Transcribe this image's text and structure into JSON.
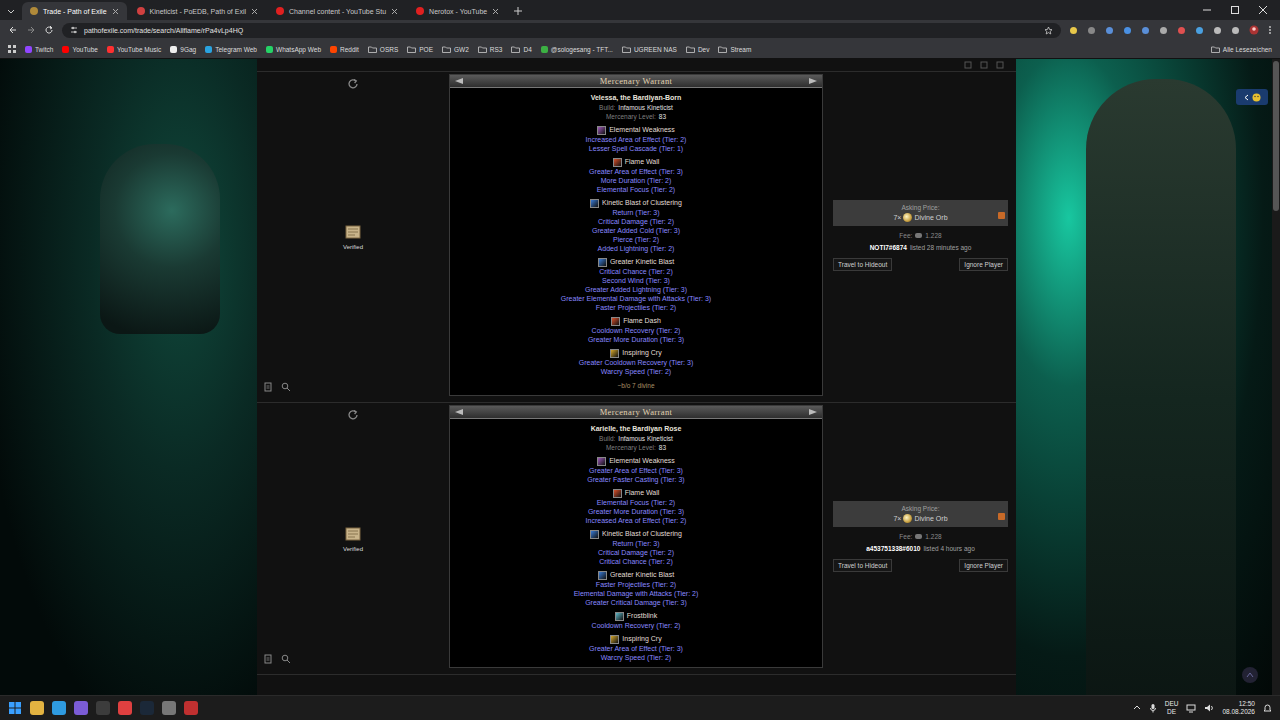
{
  "browser": {
    "tabs": [
      {
        "label": "Trade - Path of Exile",
        "selected": true,
        "color": "#b08a3a"
      },
      {
        "label": "Kineticist - PoEDB, Path of Exil",
        "selected": false,
        "color": "#d04040"
      },
      {
        "label": "Channel content - YouTube Stu",
        "selected": false,
        "color": "#e02020"
      },
      {
        "label": "Nerotox - YouTube",
        "selected": false,
        "color": "#e02020"
      }
    ],
    "address": "pathofexile.com/trade/search/Allflame/rPa4vLp4HQ",
    "bookmarks": [
      {
        "label": "Twitch",
        "kind": "link",
        "color": "#9146ff"
      },
      {
        "label": "YouTube",
        "kind": "link",
        "color": "#ff0000"
      },
      {
        "label": "YouTube Music",
        "kind": "link",
        "color": "#ff3030"
      },
      {
        "label": "9Gag",
        "kind": "link",
        "color": "#eeeeee"
      },
      {
        "label": "Telegram Web",
        "kind": "link",
        "color": "#2aa3e0"
      },
      {
        "label": "WhatsApp Web",
        "kind": "link",
        "color": "#25d366"
      },
      {
        "label": "Reddit",
        "kind": "link",
        "color": "#ff4500"
      },
      {
        "label": "OSRS",
        "kind": "folder",
        "color": "#bbbbbb"
      },
      {
        "label": "POE",
        "kind": "folder",
        "color": "#bbbbbb"
      },
      {
        "label": "GW2",
        "kind": "folder",
        "color": "#bbbbbb"
      },
      {
        "label": "RS3",
        "kind": "folder",
        "color": "#bbbbbb"
      },
      {
        "label": "D4",
        "kind": "folder",
        "color": "#bbbbbb"
      },
      {
        "label": "@sologesang - TFT...",
        "kind": "link",
        "color": "#3cb043"
      },
      {
        "label": "UGREEN NAS",
        "kind": "folder",
        "color": "#bbbbbb"
      },
      {
        "label": "Dev",
        "kind": "folder",
        "color": "#bbbbbb"
      },
      {
        "label": "Stream",
        "kind": "folder",
        "color": "#bbbbbb"
      }
    ],
    "all_bookmarks": "Alle Lesezeichen"
  },
  "listings": [
    {
      "header": "Mercenary Warrant",
      "name": "Velessa, the Bardiyan-Born",
      "build_label": "Build:",
      "build": "Infamous Kineticist",
      "level_label": "Mercenary Level:",
      "level": "83",
      "skills": [
        {
          "name": "Elemental Weakness",
          "color": "#9b59b6",
          "supports": [
            "Increased Area of Effect (Tier: 2)",
            "Lesser Spell Cascade (Tier: 1)"
          ]
        },
        {
          "name": "Flame Wall",
          "color": "#d9502a",
          "supports": [
            "Greater Area of Effect (Tier: 3)",
            "More Duration (Tier: 2)",
            "Elemental Focus (Tier: 2)"
          ]
        },
        {
          "name": "Kinetic Blast of Clustering",
          "color": "#3a7bd5",
          "supports": [
            "Return (Tier: 3)",
            "Critical Damage (Tier: 2)",
            "Greater Added Cold (Tier: 3)",
            "Pierce (Tier: 2)",
            "Added Lightning (Tier: 2)"
          ]
        },
        {
          "name": "Greater Kinetic Blast",
          "color": "#3a7bd5",
          "supports": [
            "Critical Chance (Tier: 2)",
            "Second Wind (Tier: 3)",
            "Greater Added Lightning (Tier: 3)",
            "Greater Elemental Damage with Attacks (Tier: 3)",
            "Faster Projectiles (Tier: 2)"
          ]
        },
        {
          "name": "Flame Dash",
          "color": "#d9502a",
          "supports": [
            "Cooldown Recovery (Tier: 2)",
            "Greater More Duration (Tier: 3)"
          ]
        },
        {
          "name": "Inspiring Cry",
          "color": "#d4a62a",
          "supports": [
            "Greater Cooldown Recovery (Tier: 3)",
            "Warcry Speed (Tier: 2)"
          ]
        }
      ],
      "note": "~b/o 7 divine",
      "verified": "Verified",
      "price": {
        "label": "Asking Price:",
        "amount": "7×",
        "currency": "Divine Orb",
        "fee_label": "Fee:",
        "fee": "1.228"
      },
      "seller": "NOTI7#6874",
      "listed": "listed 28 minutes ago",
      "actions": [
        "Travel to Hideout",
        "Ignore Player"
      ]
    },
    {
      "header": "Mercenary Warrant",
      "name": "Karielle, the Bardiyan Rose",
      "build_label": "Build:",
      "build": "Infamous Kineticist",
      "level_label": "Mercenary Level:",
      "level": "83",
      "skills": [
        {
          "name": "Elemental Weakness",
          "color": "#9b59b6",
          "supports": [
            "Greater Area of Effect (Tier: 3)",
            "Greater Faster Casting (Tier: 3)"
          ]
        },
        {
          "name": "Flame Wall",
          "color": "#d9502a",
          "supports": [
            "Elemental Focus (Tier: 2)",
            "Greater More Duration (Tier: 3)",
            "Increased Area of Effect (Tier: 2)"
          ]
        },
        {
          "name": "Kinetic Blast of Clustering",
          "color": "#3a7bd5",
          "supports": [
            "Return (Tier: 3)",
            "Critical Damage (Tier: 2)",
            "Critical Chance (Tier: 2)"
          ]
        },
        {
          "name": "Greater Kinetic Blast",
          "color": "#3a7bd5",
          "supports": [
            "Faster Projectiles (Tier: 2)",
            "Elemental Damage with Attacks (Tier: 2)",
            "Greater Critical Damage (Tier: 3)"
          ]
        },
        {
          "name": "Frostblink",
          "color": "#5fb8c8",
          "supports": [
            "Cooldown Recovery (Tier: 2)"
          ]
        },
        {
          "name": "Inspiring Cry",
          "color": "#d4a62a",
          "supports": [
            "Greater Area of Effect (Tier: 3)",
            "Warcry Speed (Tier: 2)"
          ]
        }
      ],
      "verified": "Verified",
      "price": {
        "label": "Asking Price:",
        "amount": "7×",
        "currency": "Divine Orb",
        "fee_label": "Fee:",
        "fee": "1.228"
      },
      "seller": "a453751338#6010",
      "listed": "listed 4 hours ago",
      "actions": [
        "Travel to Hideout",
        "Ignore Player"
      ]
    }
  ],
  "taskbar": {
    "lang": "DEU",
    "layout": "DE",
    "time": "12:50",
    "date": "08.08.2026"
  }
}
